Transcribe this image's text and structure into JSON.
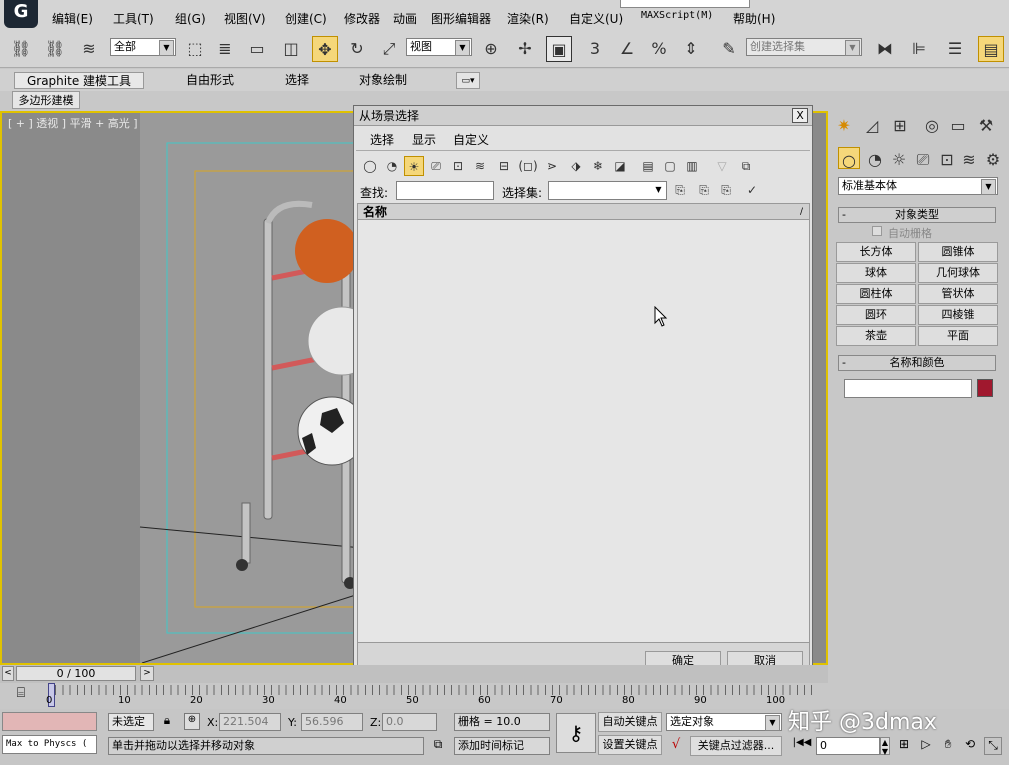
{
  "menubar": {
    "items": [
      "编辑(E)",
      "工具(T)",
      "组(G)",
      "视图(V)",
      "创建(C)",
      "修改器",
      "动画",
      "图形编辑器",
      "渲染(R)",
      "自定义(U)",
      "MAXScript(M)",
      "帮助(H)"
    ]
  },
  "toolbar": {
    "filter_value": "全部",
    "refcoord_value": "视图",
    "named_selection_placeholder": "创建选择集",
    "snap_label": "3",
    "percent_label": "%"
  },
  "ribbon": {
    "tabs": [
      "Graphite 建模工具",
      "自由形式",
      "选择",
      "对象绘制"
    ],
    "subtab": "多边形建模"
  },
  "viewport": {
    "label": "[ + ] 透视 ] 平滑 + 高光 ]"
  },
  "dialog": {
    "title": "从场景选择",
    "close_glyph": "X",
    "menus": [
      "选择",
      "显示",
      "自定义"
    ],
    "find_label": "查找:",
    "find_value": "",
    "selection_set_label": "选择集:",
    "selection_set_value": "",
    "column_header": "名称",
    "ok_label": "确定",
    "cancel_label": "取消"
  },
  "cmdpanel": {
    "category_value": "标准基本体",
    "object_type_header": "对象类型",
    "autogrid_label": "自动栅格",
    "buttons": [
      [
        "长方体",
        "圆锥体"
      ],
      [
        "球体",
        "几何球体"
      ],
      [
        "圆柱体",
        "管状体"
      ],
      [
        "圆环",
        "四棱锥"
      ],
      [
        "茶壶",
        "平面"
      ]
    ],
    "name_color_header": "名称和颜色",
    "name_value": "",
    "object_color": "#a0182e"
  },
  "timeline": {
    "frame_label": "0 / 100",
    "ticks": [
      "0",
      "10",
      "20",
      "30",
      "40",
      "50",
      "60",
      "70",
      "80",
      "90",
      "100"
    ]
  },
  "status": {
    "script_listener": "Max to Physcs (",
    "selection_status": "未选定",
    "x_label": "X:",
    "x_value": "221.504",
    "y_label": "Y:",
    "y_value": "56.596",
    "z_label": "Z:",
    "z_value": "0.0",
    "grid_label": "栅格 = 10.0",
    "prompt": "单击并拖动以选择并移动对象",
    "add_time_tag": "添加时间标记",
    "autokey_label": "自动关键点",
    "setkey_label": "设置关键点",
    "key_mode_value": "选定对象",
    "key_filters_label": "关键点过滤器...",
    "frame_value": "0"
  },
  "watermark": "知乎 @3dmax"
}
